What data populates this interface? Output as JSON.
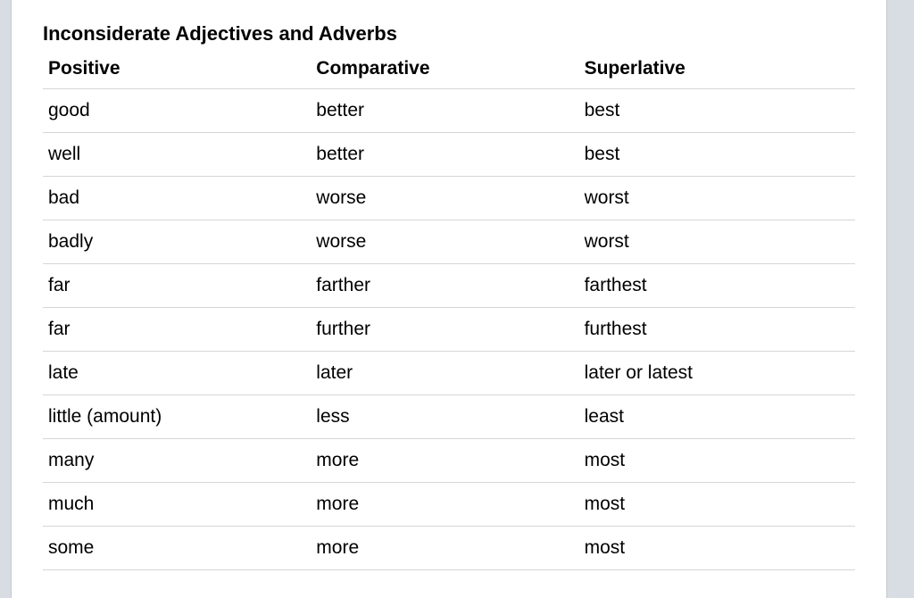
{
  "title": "Inconsiderate Adjectives and Adverbs",
  "headers": {
    "col0": "Positive",
    "col1": "Comparative",
    "col2": "Superlative"
  },
  "rows": [
    {
      "positive": "good",
      "comparative": "better",
      "superlative": "best"
    },
    {
      "positive": "well",
      "comparative": "better",
      "superlative": "best"
    },
    {
      "positive": "bad",
      "comparative": "worse",
      "superlative": "worst"
    },
    {
      "positive": "badly",
      "comparative": "worse",
      "superlative": "worst"
    },
    {
      "positive": "far",
      "comparative": "farther",
      "superlative": "farthest"
    },
    {
      "positive": "far",
      "comparative": "further",
      "superlative": "furthest"
    },
    {
      "positive": "late",
      "comparative": "later",
      "superlative": "later or latest"
    },
    {
      "positive": "little (amount)",
      "comparative": "less",
      "superlative": "least"
    },
    {
      "positive": "many",
      "comparative": "more",
      "superlative": "most"
    },
    {
      "positive": "much",
      "comparative": "more",
      "superlative": "most"
    },
    {
      "positive": "some",
      "comparative": "more",
      "superlative": "most"
    }
  ]
}
